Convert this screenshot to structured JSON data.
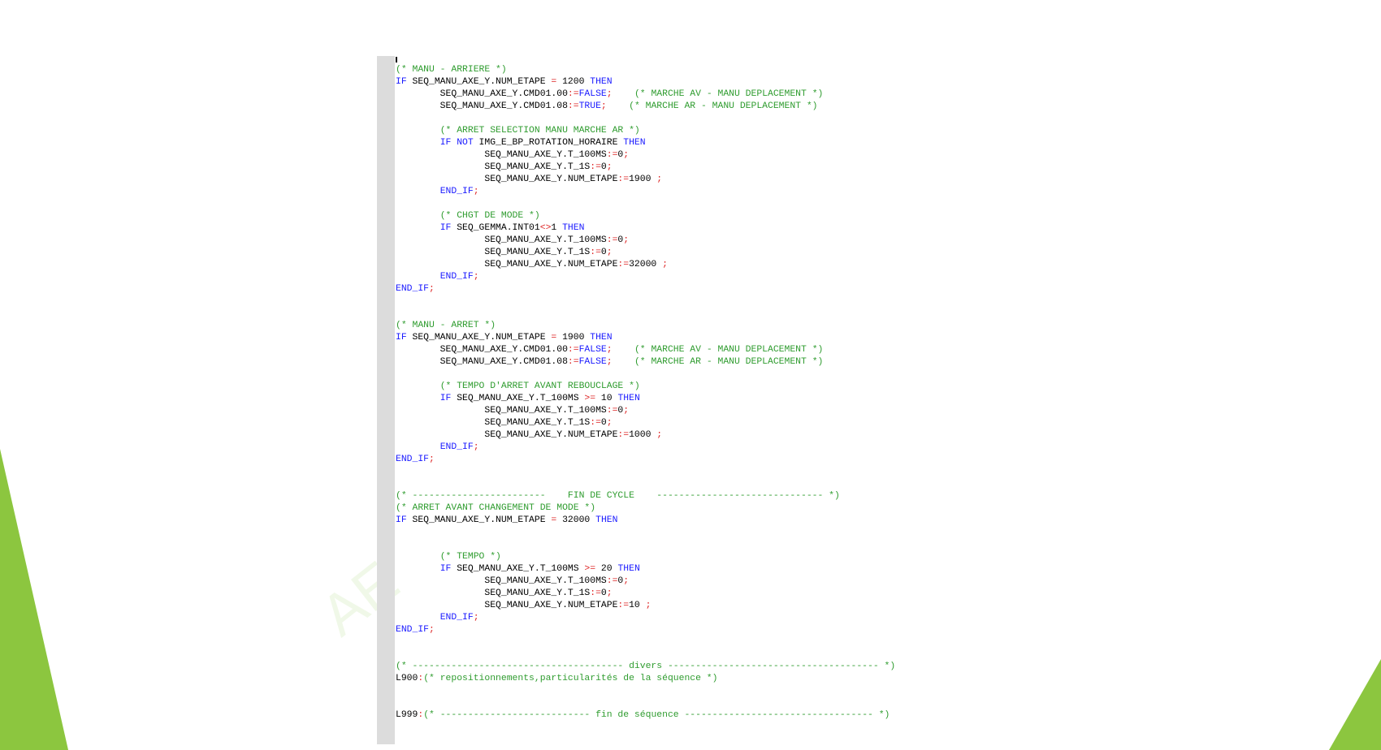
{
  "colors": {
    "background": "#ffffff",
    "keyword": "#1a1aff",
    "comment": "#2f9c2f",
    "operator": "#dd2222",
    "text": "#000000",
    "gutter": "#dcdcdc",
    "accent_green": "#8cc63f"
  },
  "watermark": "AE",
  "code_lines": [
    [
      [
        "com",
        "(* MANU - ARRIERE *)"
      ]
    ],
    [
      [
        "kw",
        "IF"
      ],
      [
        "plain",
        " SEQ_MANU_AXE_Y.NUM_ETAPE "
      ],
      [
        "op",
        "="
      ],
      [
        "plain",
        " 1200 "
      ],
      [
        "kw",
        "THEN"
      ]
    ],
    [
      [
        "plain",
        "        SEQ_MANU_AXE_Y.CMD01.00"
      ],
      [
        "op",
        ":="
      ],
      [
        "kw",
        "FALSE"
      ],
      [
        "op",
        ";"
      ],
      [
        "plain",
        "    "
      ],
      [
        "com",
        "(* MARCHE AV - MANU DEPLACEMENT *)"
      ]
    ],
    [
      [
        "plain",
        "        SEQ_MANU_AXE_Y.CMD01.08"
      ],
      [
        "op",
        ":="
      ],
      [
        "kw",
        "TRUE"
      ],
      [
        "op",
        ";"
      ],
      [
        "plain",
        "    "
      ],
      [
        "com",
        "(* MARCHE AR - MANU DEPLACEMENT *)"
      ]
    ],
    [],
    [
      [
        "plain",
        "        "
      ],
      [
        "com",
        "(* ARRET SELECTION MANU MARCHE AR *)"
      ]
    ],
    [
      [
        "plain",
        "        "
      ],
      [
        "kw",
        "IF NOT"
      ],
      [
        "plain",
        " IMG_E_BP_ROTATION_HORAIRE "
      ],
      [
        "kw",
        "THEN"
      ]
    ],
    [
      [
        "plain",
        "                SEQ_MANU_AXE_Y.T_100MS"
      ],
      [
        "op",
        ":="
      ],
      [
        "plain",
        "0"
      ],
      [
        "op",
        ";"
      ]
    ],
    [
      [
        "plain",
        "                SEQ_MANU_AXE_Y.T_1S"
      ],
      [
        "op",
        ":="
      ],
      [
        "plain",
        "0"
      ],
      [
        "op",
        ";"
      ]
    ],
    [
      [
        "plain",
        "                SEQ_MANU_AXE_Y.NUM_ETAPE"
      ],
      [
        "op",
        ":="
      ],
      [
        "plain",
        "1900 "
      ],
      [
        "op",
        ";"
      ]
    ],
    [
      [
        "plain",
        "        "
      ],
      [
        "kw",
        "END_IF"
      ],
      [
        "op",
        ";"
      ]
    ],
    [],
    [
      [
        "plain",
        "        "
      ],
      [
        "com",
        "(* CHGT DE MODE *)"
      ]
    ],
    [
      [
        "plain",
        "        "
      ],
      [
        "kw",
        "IF"
      ],
      [
        "plain",
        " SEQ_GEMMA.INT01"
      ],
      [
        "op",
        "<>"
      ],
      [
        "plain",
        "1 "
      ],
      [
        "kw",
        "THEN"
      ]
    ],
    [
      [
        "plain",
        "                SEQ_MANU_AXE_Y.T_100MS"
      ],
      [
        "op",
        ":="
      ],
      [
        "plain",
        "0"
      ],
      [
        "op",
        ";"
      ]
    ],
    [
      [
        "plain",
        "                SEQ_MANU_AXE_Y.T_1S"
      ],
      [
        "op",
        ":="
      ],
      [
        "plain",
        "0"
      ],
      [
        "op",
        ";"
      ]
    ],
    [
      [
        "plain",
        "                SEQ_MANU_AXE_Y.NUM_ETAPE"
      ],
      [
        "op",
        ":="
      ],
      [
        "plain",
        "32000 "
      ],
      [
        "op",
        ";"
      ]
    ],
    [
      [
        "plain",
        "        "
      ],
      [
        "kw",
        "END_IF"
      ],
      [
        "op",
        ";"
      ]
    ],
    [
      [
        "kw",
        "END_IF"
      ],
      [
        "op",
        ";"
      ]
    ],
    [],
    [],
    [
      [
        "com",
        "(* MANU - ARRET *)"
      ]
    ],
    [
      [
        "kw",
        "IF"
      ],
      [
        "plain",
        " SEQ_MANU_AXE_Y.NUM_ETAPE "
      ],
      [
        "op",
        "="
      ],
      [
        "plain",
        " 1900 "
      ],
      [
        "kw",
        "THEN"
      ]
    ],
    [
      [
        "plain",
        "        SEQ_MANU_AXE_Y.CMD01.00"
      ],
      [
        "op",
        ":="
      ],
      [
        "kw",
        "FALSE"
      ],
      [
        "op",
        ";"
      ],
      [
        "plain",
        "    "
      ],
      [
        "com",
        "(* MARCHE AV - MANU DEPLACEMENT *)"
      ]
    ],
    [
      [
        "plain",
        "        SEQ_MANU_AXE_Y.CMD01.08"
      ],
      [
        "op",
        ":="
      ],
      [
        "kw",
        "FALSE"
      ],
      [
        "op",
        ";"
      ],
      [
        "plain",
        "    "
      ],
      [
        "com",
        "(* MARCHE AR - MANU DEPLACEMENT *)"
      ]
    ],
    [],
    [
      [
        "plain",
        "        "
      ],
      [
        "com",
        "(* TEMPO D'ARRET AVANT REBOUCLAGE *)"
      ]
    ],
    [
      [
        "plain",
        "        "
      ],
      [
        "kw",
        "IF"
      ],
      [
        "plain",
        " SEQ_MANU_AXE_Y.T_100MS "
      ],
      [
        "op",
        ">="
      ],
      [
        "plain",
        " 10 "
      ],
      [
        "kw",
        "THEN"
      ]
    ],
    [
      [
        "plain",
        "                SEQ_MANU_AXE_Y.T_100MS"
      ],
      [
        "op",
        ":="
      ],
      [
        "plain",
        "0"
      ],
      [
        "op",
        ";"
      ]
    ],
    [
      [
        "plain",
        "                SEQ_MANU_AXE_Y.T_1S"
      ],
      [
        "op",
        ":="
      ],
      [
        "plain",
        "0"
      ],
      [
        "op",
        ";"
      ]
    ],
    [
      [
        "plain",
        "                SEQ_MANU_AXE_Y.NUM_ETAPE"
      ],
      [
        "op",
        ":="
      ],
      [
        "plain",
        "1000 "
      ],
      [
        "op",
        ";"
      ]
    ],
    [
      [
        "plain",
        "        "
      ],
      [
        "kw",
        "END_IF"
      ],
      [
        "op",
        ";"
      ]
    ],
    [
      [
        "kw",
        "END_IF"
      ],
      [
        "op",
        ";"
      ]
    ],
    [],
    [],
    [
      [
        "com",
        "(* ------------------------    FIN DE CYCLE    ------------------------------ *)"
      ]
    ],
    [
      [
        "com",
        "(* ARRET AVANT CHANGEMENT DE MODE *)"
      ]
    ],
    [
      [
        "kw",
        "IF"
      ],
      [
        "plain",
        " SEQ_MANU_AXE_Y.NUM_ETAPE "
      ],
      [
        "op",
        "="
      ],
      [
        "plain",
        " 32000 "
      ],
      [
        "kw",
        "THEN"
      ]
    ],
    [],
    [],
    [
      [
        "plain",
        "        "
      ],
      [
        "com",
        "(* TEMPO *)"
      ]
    ],
    [
      [
        "plain",
        "        "
      ],
      [
        "kw",
        "IF"
      ],
      [
        "plain",
        " SEQ_MANU_AXE_Y.T_100MS "
      ],
      [
        "op",
        ">="
      ],
      [
        "plain",
        " 20 "
      ],
      [
        "kw",
        "THEN"
      ]
    ],
    [
      [
        "plain",
        "                SEQ_MANU_AXE_Y.T_100MS"
      ],
      [
        "op",
        ":="
      ],
      [
        "plain",
        "0"
      ],
      [
        "op",
        ";"
      ]
    ],
    [
      [
        "plain",
        "                SEQ_MANU_AXE_Y.T_1S"
      ],
      [
        "op",
        ":="
      ],
      [
        "plain",
        "0"
      ],
      [
        "op",
        ";"
      ]
    ],
    [
      [
        "plain",
        "                SEQ_MANU_AXE_Y.NUM_ETAPE"
      ],
      [
        "op",
        ":="
      ],
      [
        "plain",
        "10 "
      ],
      [
        "op",
        ";"
      ]
    ],
    [
      [
        "plain",
        "        "
      ],
      [
        "kw",
        "END_IF"
      ],
      [
        "op",
        ";"
      ]
    ],
    [
      [
        "kw",
        "END_IF"
      ],
      [
        "op",
        ";"
      ]
    ],
    [],
    [],
    [
      [
        "com",
        "(* -------------------------------------- divers -------------------------------------- *)"
      ]
    ],
    [
      [
        "plain",
        "L900"
      ],
      [
        "op",
        ":"
      ],
      [
        "com",
        "(* repositionnements,particularités de la séquence *)"
      ]
    ],
    [],
    [],
    [
      [
        "plain",
        "L999"
      ],
      [
        "op",
        ":"
      ],
      [
        "com",
        "(* --------------------------- fin de séquence ---------------------------------- *)"
      ]
    ]
  ]
}
